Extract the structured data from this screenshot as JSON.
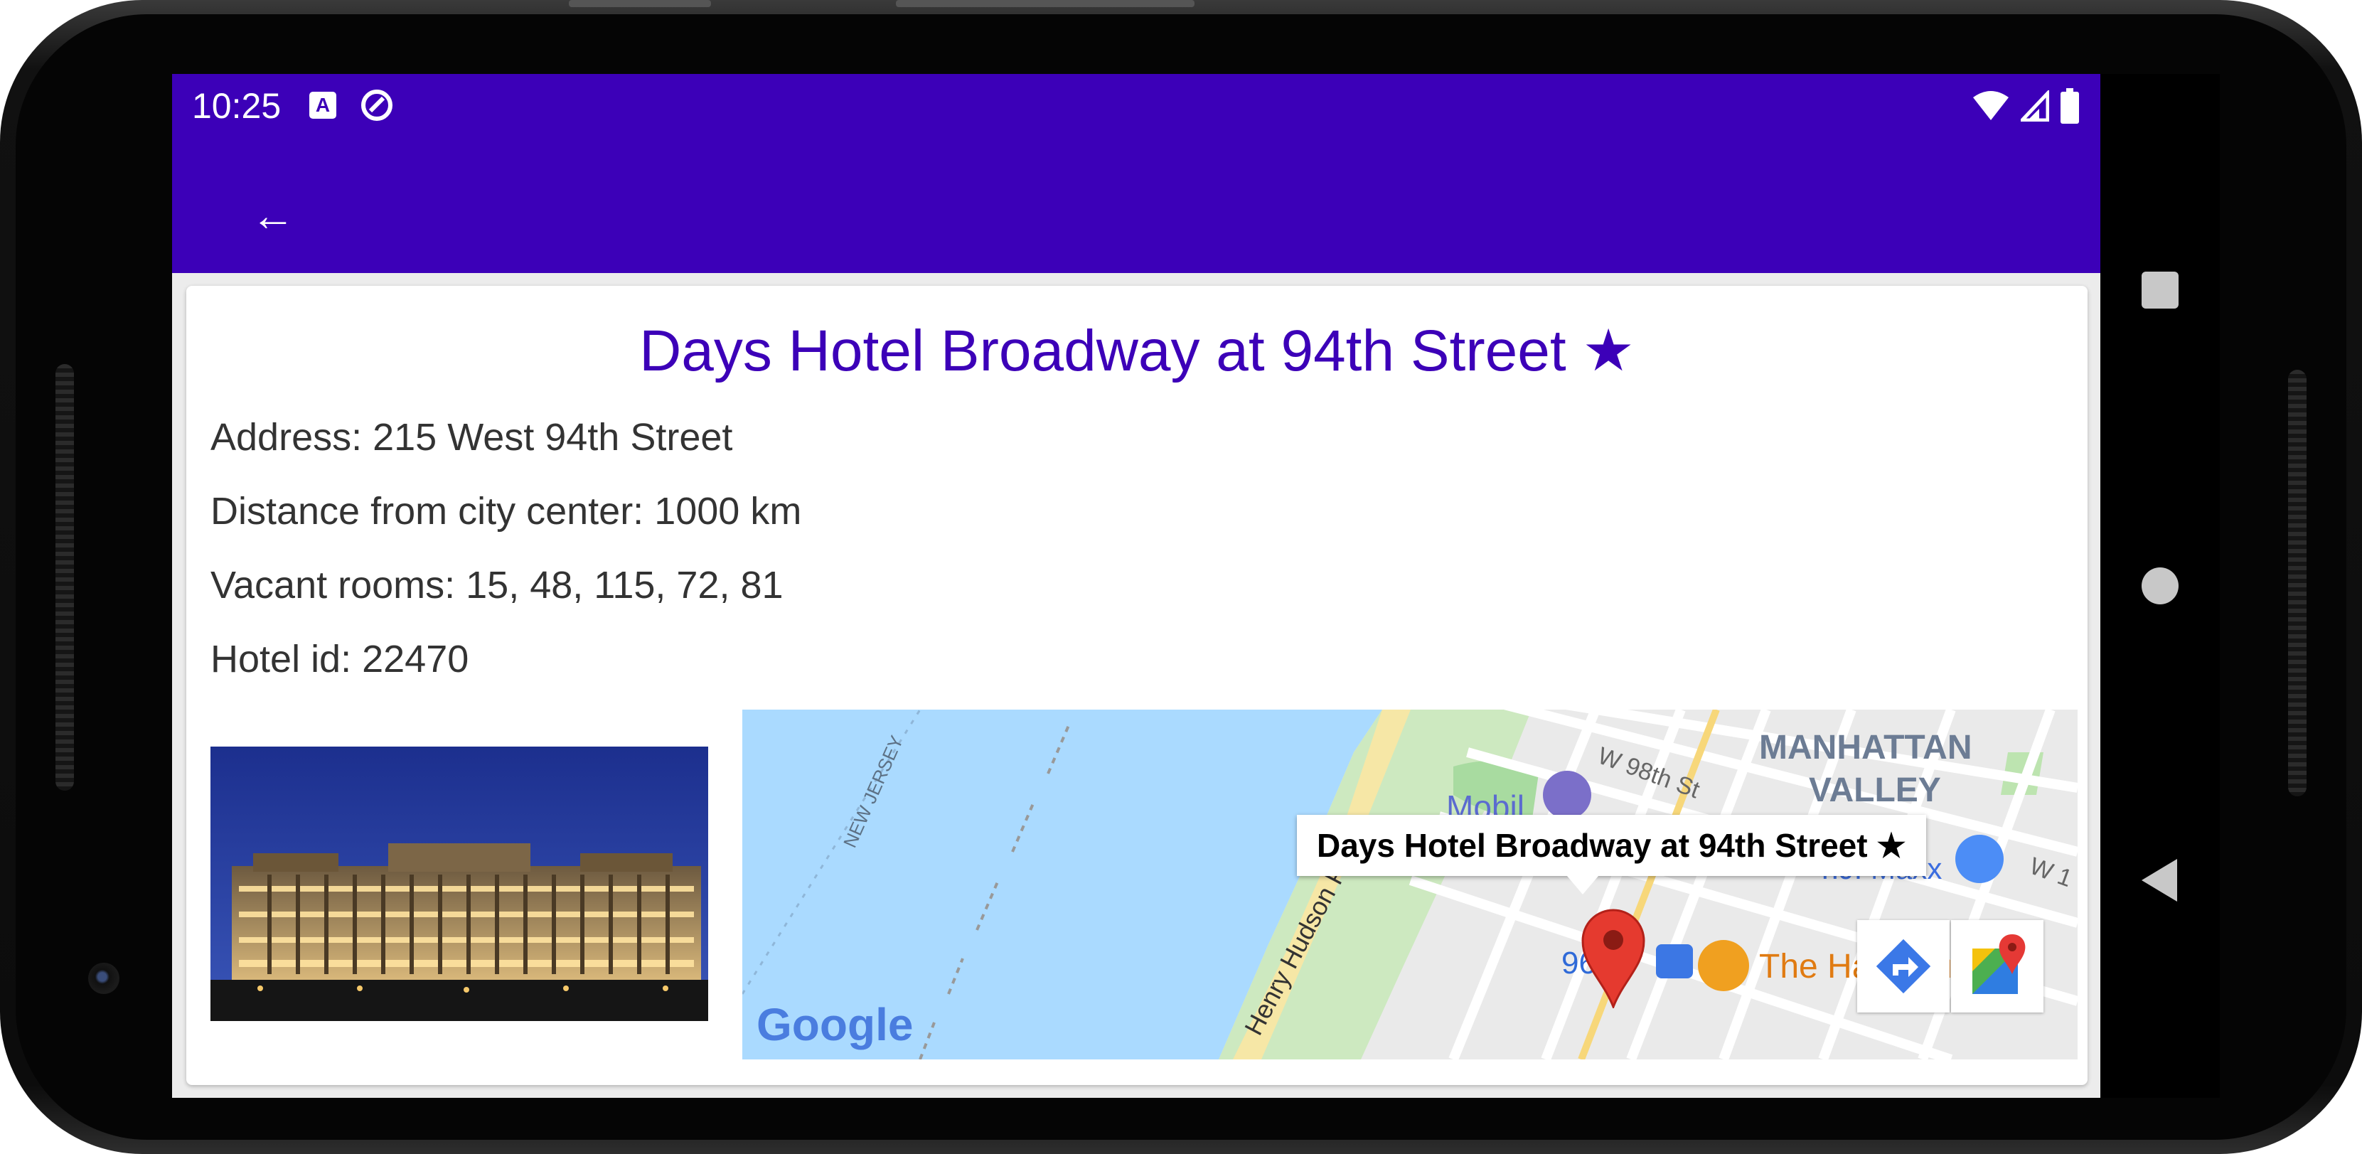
{
  "status_bar": {
    "time": "10:25",
    "notification_icons": [
      "a-icon",
      "sync-icon"
    ],
    "system_icons": [
      "wifi-icon",
      "signal-icon",
      "battery-icon"
    ]
  },
  "app_bar": {
    "back_icon": "←",
    "color": "#3c00b8"
  },
  "hotel": {
    "title": "Days Hotel Broadway at 94th Street ★",
    "address": "Address: 215 West 94th Street",
    "distance": "Distance from city center: 1000 km",
    "vacant_rooms": "Vacant rooms: 15, 48, 115, 72, 81",
    "hotel_id": "Hotel id: 22470"
  },
  "map": {
    "info_window_title": "Days Hotel Broadway at 94th Street ★",
    "labels": {
      "manhattan": "MANHATTAN",
      "valley": "VALLEY",
      "street_98": "W 98th St",
      "mobil": "Mobil",
      "new_jersey": "NEW JERSEY",
      "henry_hudson": "Henry Hudson Pkwy",
      "hala": "The Hala Guys",
      "maxx": "T.J. Maxx",
      "station": "96",
      "w_partial": "W 1",
      "google": "Google"
    },
    "buttons": [
      "directions-icon",
      "google-maps-icon"
    ]
  },
  "nav_bar": {
    "buttons": [
      "recents",
      "home",
      "back"
    ]
  }
}
